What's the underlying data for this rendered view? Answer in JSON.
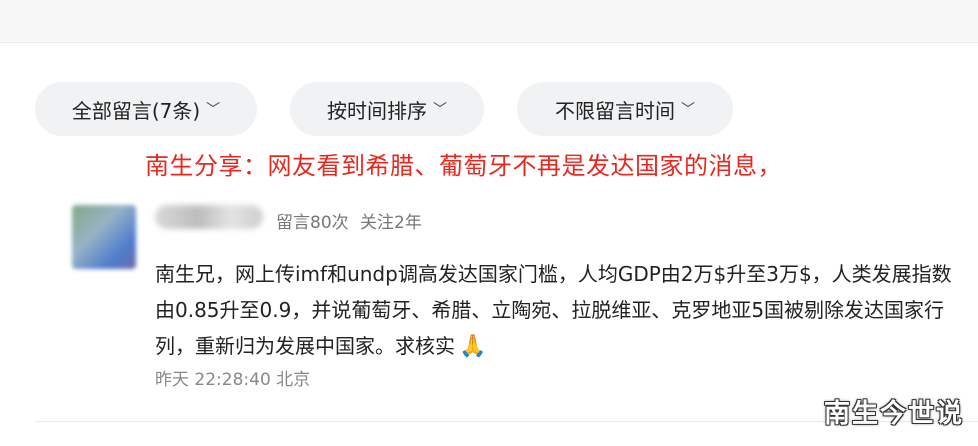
{
  "filters": [
    {
      "label": "全部留言(7条)"
    },
    {
      "label": "按时间排序"
    },
    {
      "label": "不限留言时间"
    }
  ],
  "headline": "南生分享：网友看到希腊、葡萄牙不再是发达国家的消息，",
  "comment": {
    "stats_posts": "留言80次",
    "stats_follow": "关注2年",
    "text": "南生兄，网上传imf和undp调高发达国家门槛，人均GDP由2万$升至3万$，人类发展指数由0.85升至0.9，并说葡萄牙、希腊、立陶宛、拉脱维亚、克罗地亚5国被剔除发达国家行列，重新归为发展中国家。求核实",
    "emoji": "🙏",
    "time": "昨天 22:28:40 北京"
  },
  "watermark": "南生今世说",
  "colors": {
    "headline": "#e8281f",
    "filter_bg": "#f1f2f4"
  }
}
